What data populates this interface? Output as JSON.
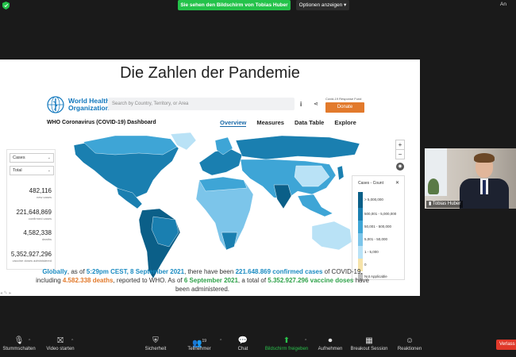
{
  "topbar": {
    "share_notice": "Sie sehen den Bildschirm von Tobias Huber",
    "options_button": "Optionen anzeigen",
    "view_button": "An"
  },
  "slide": {
    "title": "Die Zahlen der Pandemie"
  },
  "who": {
    "org_name": "World Health Organization",
    "search_placeholder": "Search by Country, Territory, or Area",
    "fund_label": "Covid-19 Response Fund",
    "donate_label": "Donate",
    "dashboard_title": "WHO Coronavirus (COVID-19) Dashboard",
    "nav": [
      {
        "label": "Overview",
        "active": true
      },
      {
        "label": "Measures",
        "active": false
      },
      {
        "label": "Data Table",
        "active": false
      },
      {
        "label": "Explore",
        "active": false
      }
    ],
    "filters": {
      "metric_value": "Cases",
      "period_value": "Total"
    },
    "stats": [
      {
        "value": "482,116",
        "label": "new cases"
      },
      {
        "value": "221,648,869",
        "label": "confirmed cases"
      },
      {
        "value": "4,582,338",
        "label": "deaths"
      },
      {
        "value": "5,352,927,296",
        "label": "vaccine doses administered"
      }
    ],
    "legend": {
      "title": "Cases - Count",
      "items": [
        {
          "label": "> 5,000,000",
          "color": "#0b5f88"
        },
        {
          "label": "500,001 - 5,000,000",
          "color": "#1a7fb0"
        },
        {
          "label": "50,001 - 500,000",
          "color": "#3ea5d6"
        },
        {
          "label": "5,001 - 50,000",
          "color": "#7cc5ea"
        },
        {
          "label": "1 - 5,000",
          "color": "#b9e2f6"
        },
        {
          "label": "0",
          "color": "#f6e3a9"
        },
        {
          "label": "Not Applicable",
          "color": "#bdbdbd"
        }
      ]
    },
    "caption": {
      "p1": "Globally",
      "p2": ", as of ",
      "p3": "5:29pm CEST, 8 September 2021",
      "p4": ", there have been ",
      "p5": "221.648.869 confirmed cases",
      "p6": " of COVID-19, including ",
      "p7": "4.582.338 deaths",
      "p8": ", reported to WHO. As of ",
      "p9": "6 September 2021",
      "p10": ", a total of ",
      "p11": "5.352.927.296 vaccine doses",
      "p12": " have been administered."
    }
  },
  "participant": {
    "name": "Tobias Huber"
  },
  "controls": {
    "mute": "Stummschalten",
    "video": "Video starten",
    "security": "Sicherheit",
    "participants": "Teilnehmer",
    "participant_count": "19",
    "chat": "Chat",
    "share": "Bildschirm freigeben",
    "record": "Aufnehmen",
    "breakout": "Breakout Session",
    "reactions": "Reaktionen",
    "leave": "Verlass"
  },
  "colors": {
    "accent_green": "#24c24a",
    "leave_red": "#e0392a",
    "who_blue": "#1077bd"
  }
}
